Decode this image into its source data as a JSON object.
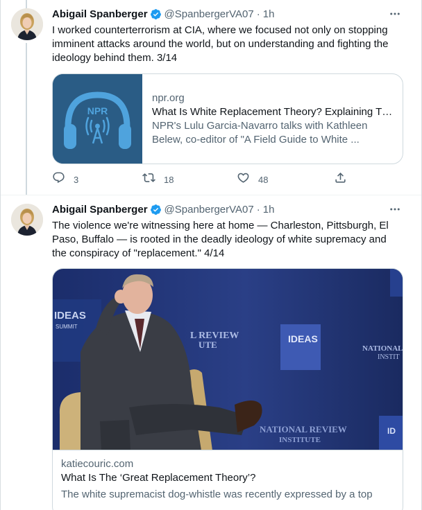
{
  "tweets": [
    {
      "author": {
        "name": "Abigail Spanberger",
        "handle": "@SpanbergerVA07",
        "verified": true
      },
      "separator": "·",
      "time": "1h",
      "text": "I worked counterterrorism at CIA, where we focused not only on stopping imminent attacks around the world, but on understanding and fighting the ideology behind them. 3/14",
      "card": {
        "domain": "npr.org",
        "title": "What Is White Replacement Theory? Explaining Th...",
        "description": "NPR's Lulu Garcia-Navarro talks with Kathleen Belew, co-editor of \"A Field Guide to White ...",
        "thumb_label": "NPR",
        "thumb_color": "#2a5c85"
      },
      "actions": {
        "replies": "3",
        "retweets": "18",
        "likes": "48"
      }
    },
    {
      "author": {
        "name": "Abigail Spanberger",
        "handle": "@SpanbergerVA07",
        "verified": true
      },
      "separator": "·",
      "time": "1h",
      "text": "The violence we're witnessing here at home — Charleston, Pittsburgh, El Paso, Buffalo — is rooted in the deadly ideology of white supremacy and the conspiracy of \"replacement.\" 4/14",
      "card": {
        "domain": "katiecouric.com",
        "title": "What Is The ‘Great Replacement Theory’?",
        "description": "The white supremacist dog-whistle was recently expressed by a top",
        "image_texts": [
          "IDEAS",
          "SUMMIT",
          "L REVIEW",
          "UTE",
          "IDEAS",
          "NATIONAL",
          "INSTIT",
          "NATIONAL REVIEW",
          "INSTITUTE",
          "ID"
        ]
      }
    }
  ],
  "icons": {
    "more": "more-horizontal-icon",
    "verified": "verified-badge-icon",
    "reply": "reply-icon",
    "retweet": "retweet-icon",
    "like": "heart-icon",
    "share": "share-icon"
  },
  "colors": {
    "verified": "#1d9bf0",
    "secondary_text": "#536471",
    "border": "#cfd9de",
    "primary_text": "#0f1419"
  }
}
